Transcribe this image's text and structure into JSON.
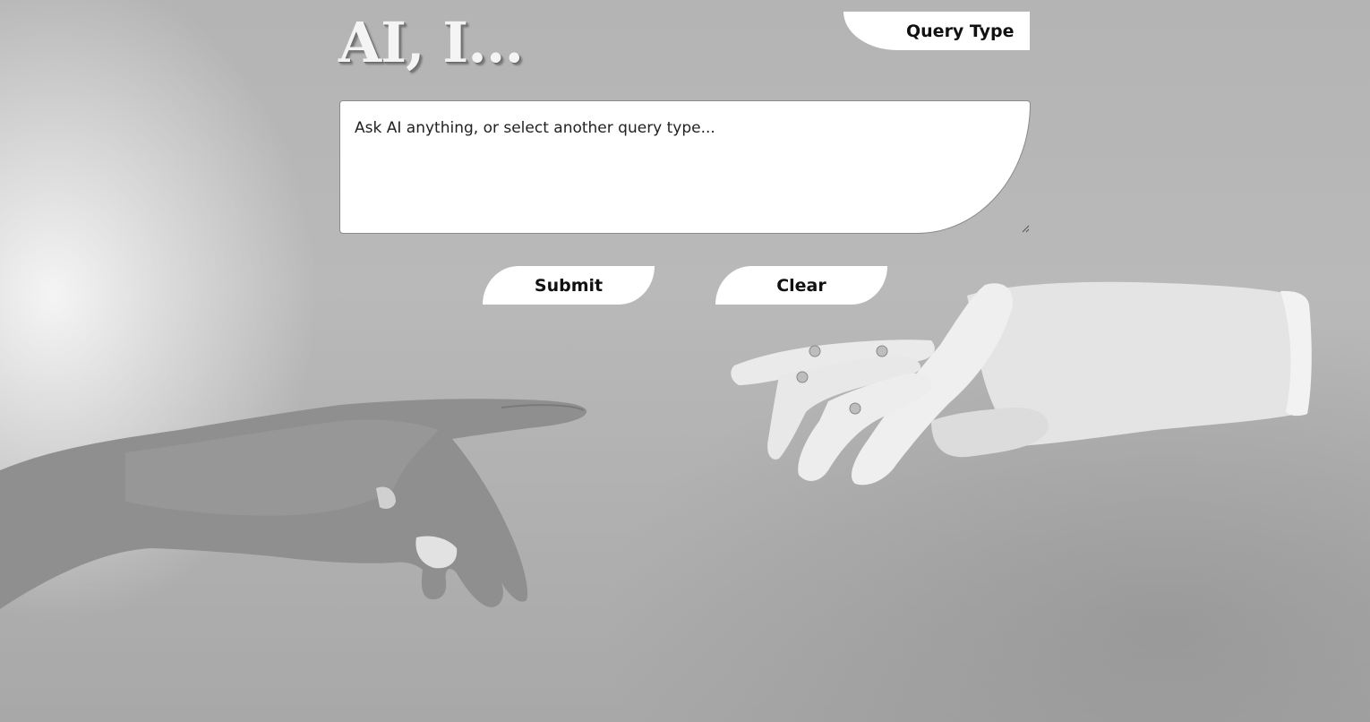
{
  "header": {
    "title": "AI, I..."
  },
  "query_type": {
    "label": "Query Type"
  },
  "query": {
    "placeholder": "Ask AI anything, or select another query type...",
    "value": ""
  },
  "actions": {
    "submit_label": "Submit",
    "clear_label": "Clear"
  },
  "background": {
    "image": "human-hand-reaching-robot-hand",
    "palette": [
      "#b4b4b4",
      "#f0f0f0",
      "#8a8a8a"
    ]
  }
}
